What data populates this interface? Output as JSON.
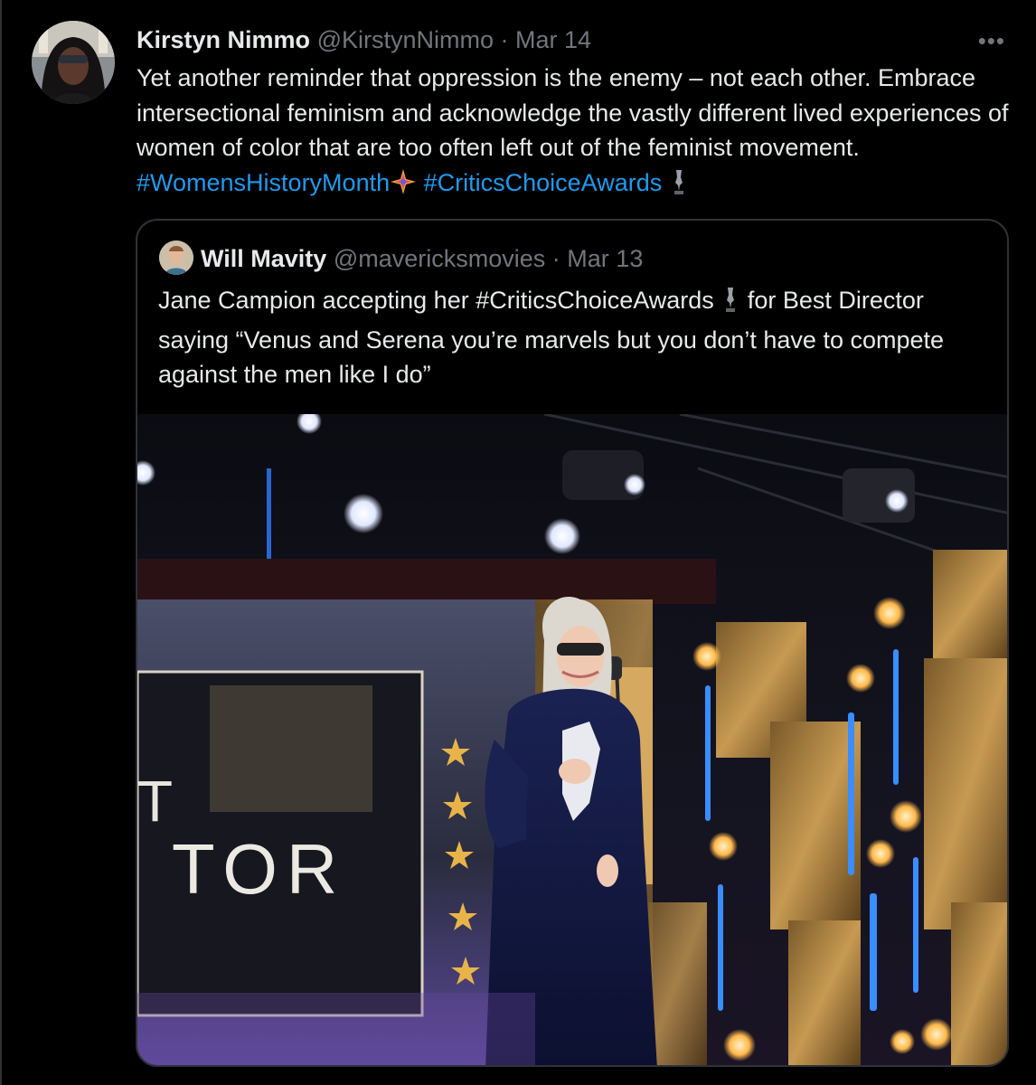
{
  "tweet": {
    "author_name": "Kirstyn Nimmo",
    "author_handle": "@KirstynNimmo",
    "separator": "·",
    "date": "Mar 14",
    "more_label": "•••",
    "text_part1": "Yet another reminder that oppression is the enemy – not each other. Embrace intersectional feminism and acknowledge the vastly different lived experiences of women of color that are too often left out of the  feminist movement. ",
    "hashtag1": "#WomensHistoryMonth",
    "hashtag2": "#CriticsChoiceAwards",
    "hashtag1_emoji": "sparkle-star-icon",
    "hashtag2_emoji": "trophy-icon"
  },
  "quoted_tweet": {
    "author_name": "Will Mavity",
    "author_handle": "@mavericksmovies",
    "separator": "·",
    "date": "Mar 13",
    "text_part1": "Jane Campion accepting her ",
    "hashtag": "#CriticsChoiceAwards",
    "text_part2": " for Best Director saying “Venus and Serena you’re marvels but you don’t have to compete against the men like I do”",
    "media": {
      "screen_text": "TOR",
      "screen_text_left": "T"
    }
  },
  "colors": {
    "background": "#000000",
    "text": "#e7e9ea",
    "secondary": "#71767b",
    "link": "#1d9bf0",
    "border": "#2f3336"
  }
}
